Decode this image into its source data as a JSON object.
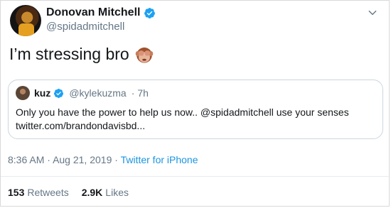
{
  "tweet": {
    "author": {
      "display_name": "Donovan Mitchell",
      "handle": "@spidadmitchell",
      "verified": true,
      "avatar_icon": "profile-photo"
    },
    "menu_icon": "chevron-down-icon",
    "text": "I’m stressing bro",
    "emoji_icon": "see-no-evil-monkey-emoji",
    "quoted": {
      "display_name": "kuz",
      "handle": "@kylekuzma",
      "separator": "·",
      "time": "7h",
      "verified": true,
      "text_line1": "Only you have the power to help us now.. @spidadmitchell use your senses",
      "text_line2": "twitter.com/brandondavisbd..."
    },
    "meta": {
      "time": "8:36 AM",
      "sep1": "·",
      "date": "Aug 21, 2019",
      "sep2": "·",
      "source": "Twitter for iPhone"
    },
    "stats": {
      "retweets_count": "153",
      "retweets_label": "Retweets",
      "likes_count": "2.9K",
      "likes_label": "Likes"
    }
  },
  "colors": {
    "text": "#14171a",
    "secondary": "#657786",
    "link": "#1b95e0",
    "verified": "#1da1f2",
    "border": "#ccd6dd"
  }
}
